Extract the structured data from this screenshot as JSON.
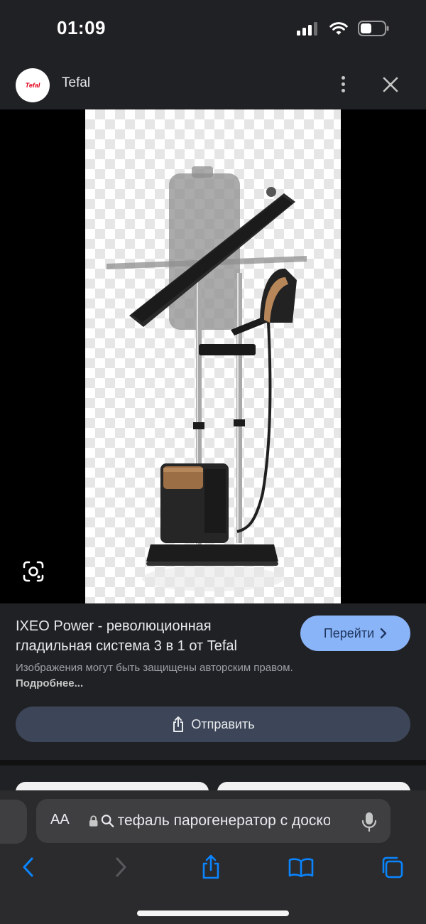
{
  "status_bar": {
    "time": "01:09"
  },
  "header": {
    "logo_text": "Tefal",
    "source_name": "Tefal"
  },
  "result": {
    "title": "IXEO Power - революционная гладильная система 3 в 1 от Tefal",
    "visit_label": "Перейти",
    "copyright_text": "Изображения могут быть защищены авторским правом.",
    "more_link": "Подробнее...",
    "share_label": "Отправить"
  },
  "browser": {
    "aa_label": "AA",
    "address_text": "тефаль парогенератор с доской"
  },
  "icons": {
    "signal": "signal-icon",
    "wifi": "wifi-icon",
    "battery": "battery-icon",
    "more": "more-vert-icon",
    "close": "close-icon",
    "lens": "google-lens-icon",
    "visit": "chevron-right-icon",
    "share": "share-icon",
    "lock": "lock-icon",
    "search": "search-icon",
    "mic": "mic-icon",
    "back": "back-icon",
    "forward": "forward-icon",
    "bookmarks": "bookmarks-icon",
    "tabs": "tabs-icon"
  },
  "colors": {
    "accent": "#8ab4f8",
    "nav_active": "#0a84ff",
    "brand": "#e2001a"
  }
}
